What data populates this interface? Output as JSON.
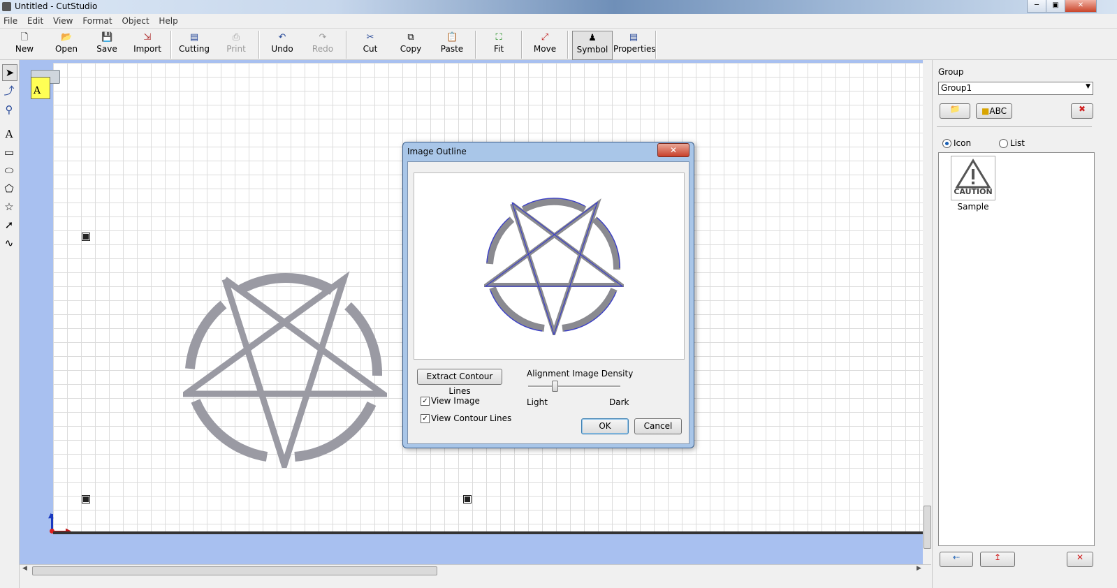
{
  "window": {
    "title": "Untitled - CutStudio"
  },
  "menu": [
    "File",
    "Edit",
    "View",
    "Format",
    "Object",
    "Help"
  ],
  "toolbar": {
    "new": "New",
    "open": "Open",
    "save": "Save",
    "import": "Import",
    "cutting": "Cutting",
    "print": "Print",
    "undo": "Undo",
    "redo": "Redo",
    "cut": "Cut",
    "copy": "Copy",
    "paste": "Paste",
    "fit": "Fit",
    "move": "Move",
    "symbol": "Symbol",
    "properties": "Properties"
  },
  "right_panel": {
    "group_label": "Group",
    "group_value": "Group1",
    "abc_button": "ABC",
    "view_icon": "Icon",
    "view_list": "List",
    "symbol_sample_label": "Sample",
    "symbol_caution_text": "CAUTION"
  },
  "dialog": {
    "title": "Image Outline",
    "extract_button": "Extract Contour Lines",
    "density_label": "Alignment Image Density",
    "density_light": "Light",
    "density_dark": "Dark",
    "density_level": 0.3,
    "view_image": "View Image",
    "view_contour": "View Contour Lines",
    "ok": "OK",
    "cancel": "Cancel"
  },
  "colors": {
    "canvas_bg": "#a8c0f0",
    "contour": "#3b3fc8",
    "image_gray": "#9a9aa3"
  }
}
